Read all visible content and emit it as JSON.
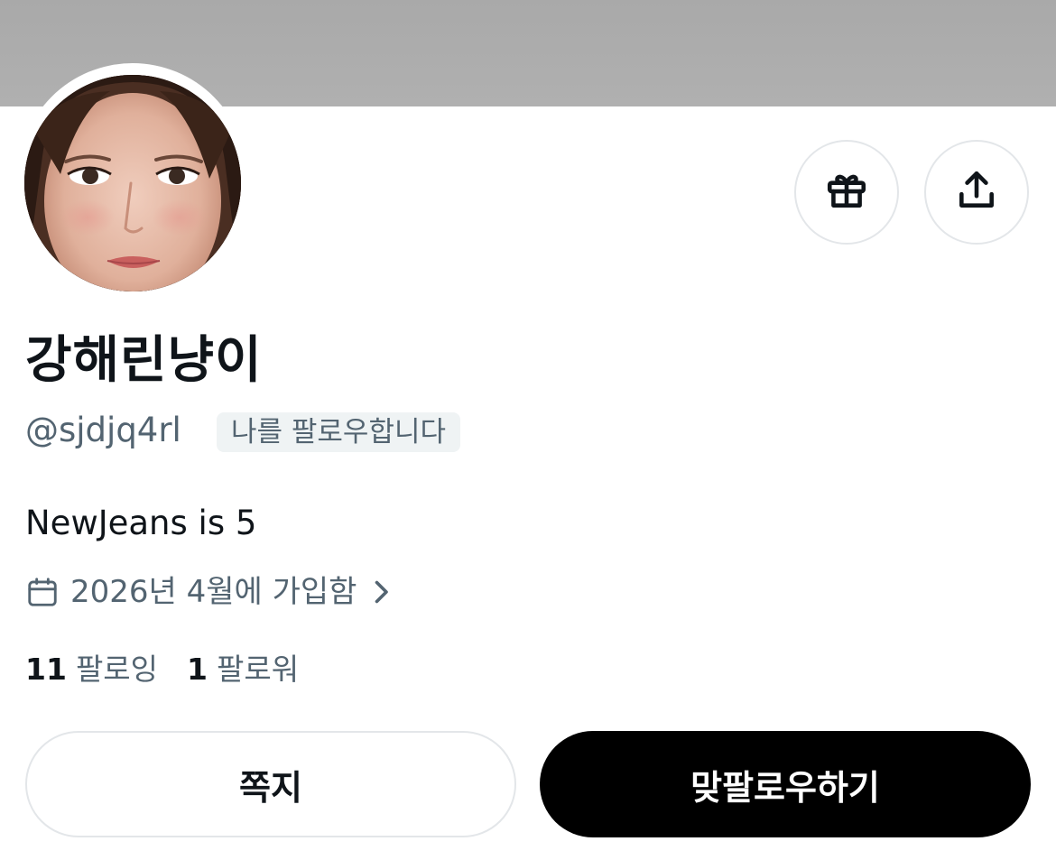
{
  "profile": {
    "display_name": "강해린냥이",
    "handle": "@sjdjq4rl",
    "follows_you_label": "나를 팔로우합니다",
    "bio": "NewJeans is 5",
    "joined_text": "2026년 4월에 가입함"
  },
  "stats": {
    "following_count": "11",
    "following_label": "팔로잉",
    "followers_count": "1",
    "followers_label": "팔로워"
  },
  "actions": {
    "message_label": "쪽지",
    "follow_back_label": "맞팔로우하기"
  },
  "icons": {
    "gift": "gift-icon",
    "share": "share-icon",
    "calendar": "calendar-icon",
    "chevron": "chevron-right-icon"
  },
  "colors": {
    "banner": "#acacac",
    "text_primary": "#0f1419",
    "text_secondary": "#536471",
    "badge_bg": "#eff3f4",
    "border": "#e3e6e9",
    "primary_button_bg": "#000000",
    "primary_button_text": "#ffffff"
  }
}
